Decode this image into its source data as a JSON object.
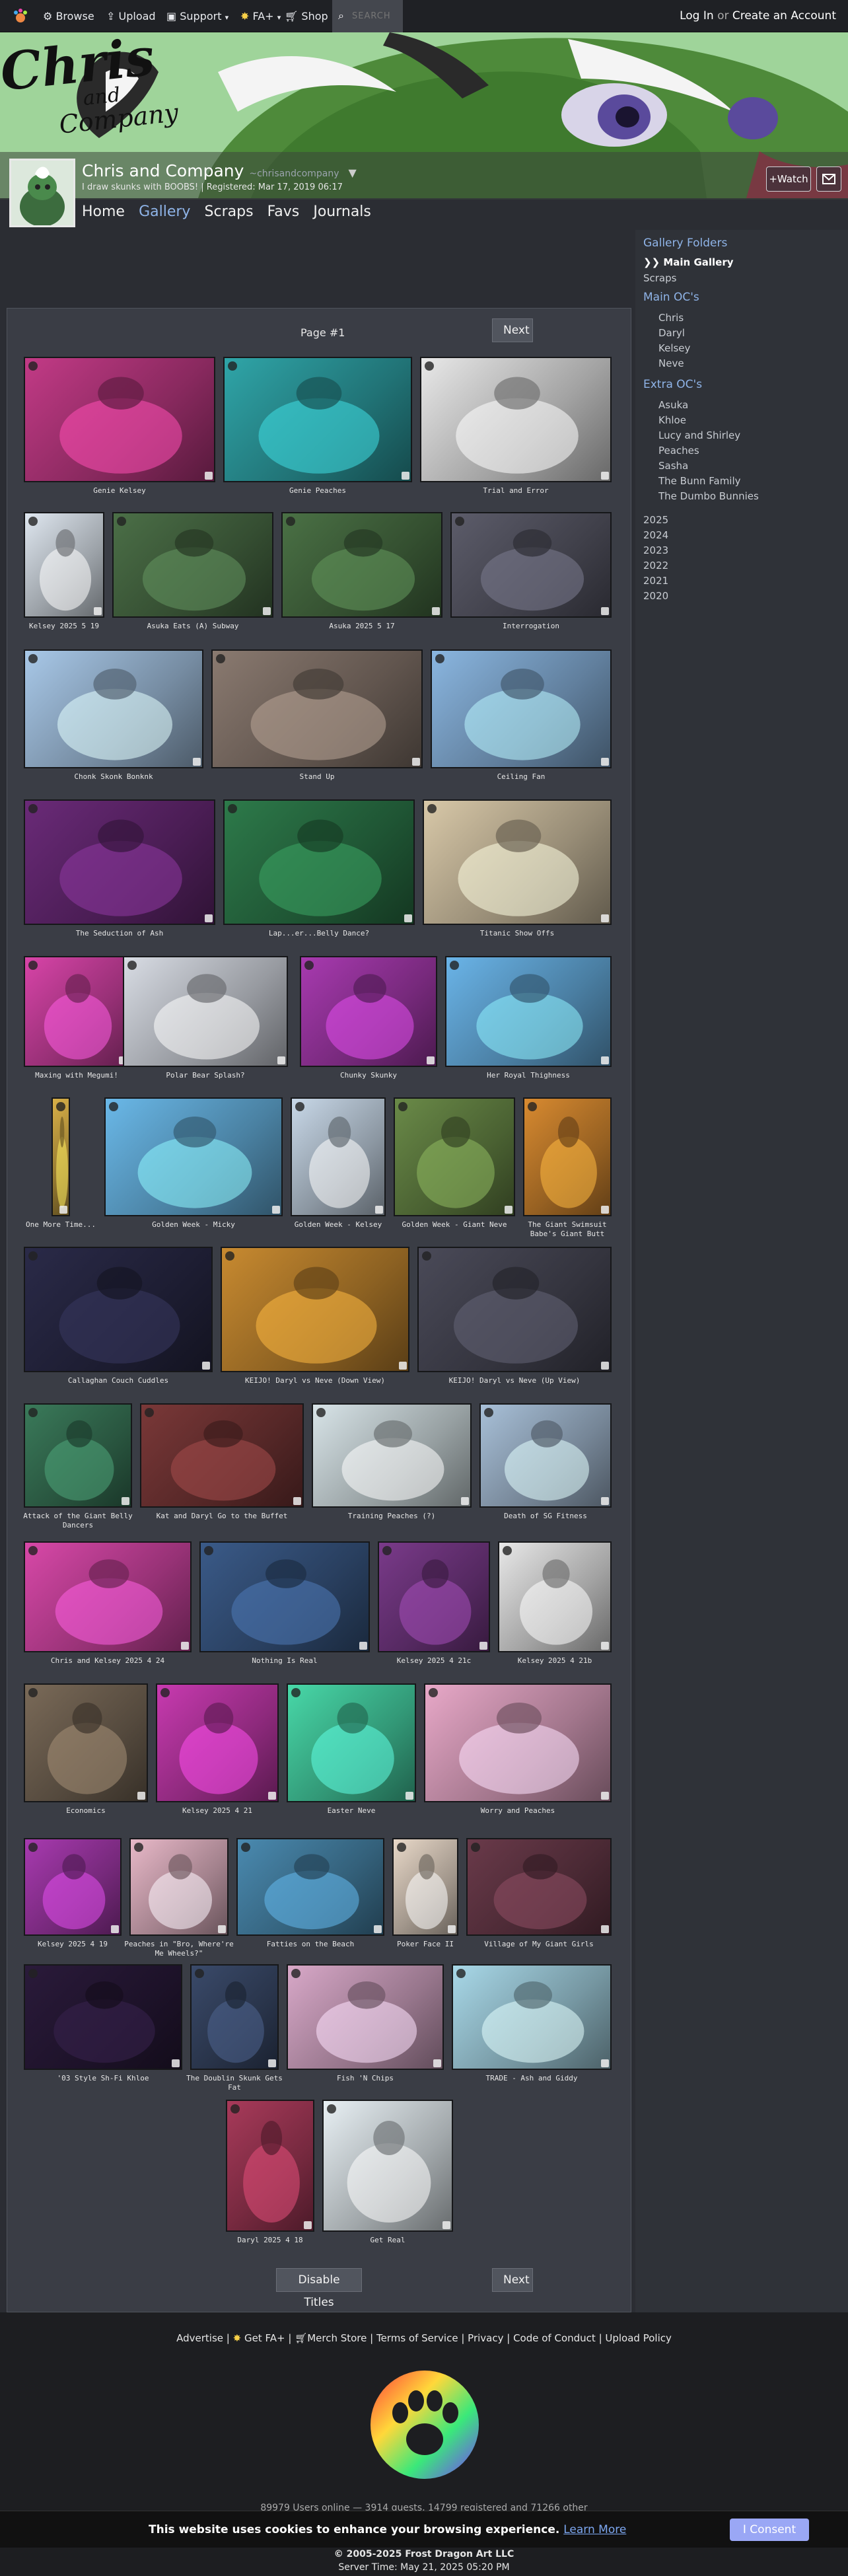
{
  "topnav": {
    "browse": "Browse",
    "upload": "Upload",
    "support": "Support",
    "fa_plus": "FA+",
    "shop": "Shop",
    "search_placeholder": "SEARCH",
    "login": "Log In",
    "or": "or",
    "create_account": "Create an Account"
  },
  "profile": {
    "name": "Chris and Company",
    "handle": "~chrisandcompany",
    "tagline": "I draw skunks with BOOBS! | Registered: Mar 17, 2019 06:17",
    "watch_label": "+Watch",
    "banner_logo_line1": "Chris",
    "banner_logo_line2": "and",
    "banner_logo_line3": "Company"
  },
  "subnav": [
    "Home",
    "Gallery",
    "Scraps",
    "Favs",
    "Journals"
  ],
  "sidebar": {
    "gallery_folders": "Gallery Folders",
    "main_gallery": "❯❯ Main Gallery",
    "scraps": "Scraps",
    "main_ocs": "Main OC's",
    "main_oc_items": [
      "Chris",
      "Daryl",
      "Kelsey",
      "Neve"
    ],
    "extra_ocs": "Extra OC's",
    "extra_oc_items": [
      "Asuka",
      "Khloe",
      "Lucy and Shirley",
      "Peaches",
      "Sasha",
      "The Bunn Family",
      "The Dumbo Bunnies"
    ],
    "years": [
      "2025",
      "2024",
      "2023",
      "2022",
      "2021",
      "2020"
    ]
  },
  "gallery": {
    "page_label": "Page #1",
    "next_label": "Next",
    "disable_titles_label": "Disable Titles",
    "captions": [
      "Genie Kelsey",
      "Genie Peaches",
      "Trial and Error",
      "Kelsey 2025 5 19",
      "Asuka Eats (A) Subway",
      "Asuka 2025 5 17",
      "Interrogation",
      "Chonk Skonk Bonknk",
      "Stand Up",
      "Ceiling Fan",
      "The Seduction of Ash",
      "Lap...er...Belly Dance?",
      "Titanic Show Offs",
      "Maxing with Megumi!",
      "Polar Bear Splash?",
      "Chunky Skunky",
      "Her Royal Thighness",
      "One More Time...",
      "Golden Week - Micky",
      "Golden Week - Kelsey",
      "Golden Week - Giant Neve",
      "The Giant Swimsuit Babe's Giant Butt",
      "Callaghan Couch Cuddles",
      "KEIJO! Daryl vs Neve (Down View)",
      "KEIJO! Daryl vs Neve (Up View)",
      "Attack of the Giant Belly Dancers",
      "Kat and Daryl Go to the Buffet",
      "Training Peaches (?)",
      "Death of SG Fitness",
      "Chris and Kelsey 2025 4 24",
      "Nothing Is Real",
      "Kelsey 2025 4 21c",
      "Kelsey 2025 4 21b",
      "Economics",
      "Kelsey 2025 4 21",
      "Easter Neve",
      "Worry and Peaches",
      "Kelsey 2025 4 19",
      "Peaches in \"Bro, Where're Me Wheels?\"",
      "Fatties on the Beach",
      "Poker Face II",
      "Village of My Giant Girls",
      "'03 Style Sh-Fi Khloe",
      "The Doublin Skunk Gets Fat",
      "Fish 'N Chips",
      "TRADE - Ash and Giddy",
      "Daryl 2025 4 18",
      "Get Real"
    ],
    "thumb_colors": [
      "#c23a86",
      "#2fa5a8",
      "#e8e8e8",
      "#dfe7f0",
      "#4b6f47",
      "#4a7145",
      "#5c5c6a",
      "#a8c8e8",
      "#8a7a70",
      "#8ab6e0",
      "#6a2a78",
      "#2d7a4a",
      "#d8c8a8",
      "#d844a8",
      "#d8dce4",
      "#a83ab0",
      "#6ab4e8",
      "#d8b048",
      "#6ab8e8",
      "#c8d8e8",
      "#6a8a48",
      "#d88a30",
      "#2a2a48",
      "#c88a30",
      "#4a4a58",
      "#3a7a5a",
      "#7a3838",
      "#d8e4e8",
      "#a8c0d8",
      "#d848a8",
      "#3a5a88",
      "#7a3a8a",
      "#e8e8e8",
      "#7a6a58",
      "#c83ab0",
      "#48d8a8",
      "#e8a8c8",
      "#a83ab0",
      "#e8b8c8",
      "#4a8ab0",
      "#e8d8c8",
      "#6a3a4a",
      "#2a1a3a",
      "#3a4a6a",
      "#d8a8c8",
      "#a8d8e8",
      "#a83a5a",
      "#e8f0f4"
    ]
  },
  "footer": {
    "advertise": "Advertise",
    "get_fa_plus": "Get FA+",
    "merch_store": "Merch Store",
    "terms": "Terms of Service",
    "privacy": "Privacy",
    "code_of_conduct": "Code of Conduct",
    "upload_policy": "Upload Policy",
    "online_stats": "89979 Users online — 3914 guests, 14799 registered and 71266 other",
    "copyright": "© 2005-2025 Frost Dragon Art LLC",
    "server_time": "Server Time: May 21, 2025 05:20 PM"
  },
  "cookie": {
    "text": "This website uses cookies to enhance your browsing experience.",
    "learn_more": "Learn More",
    "consent": "I Consent"
  },
  "colors": {
    "topnav_bg": "#1f2125",
    "page_bg": "#2b2d33",
    "accent_link": "#8fb4e8",
    "consent_button": "#9aa7f5"
  }
}
